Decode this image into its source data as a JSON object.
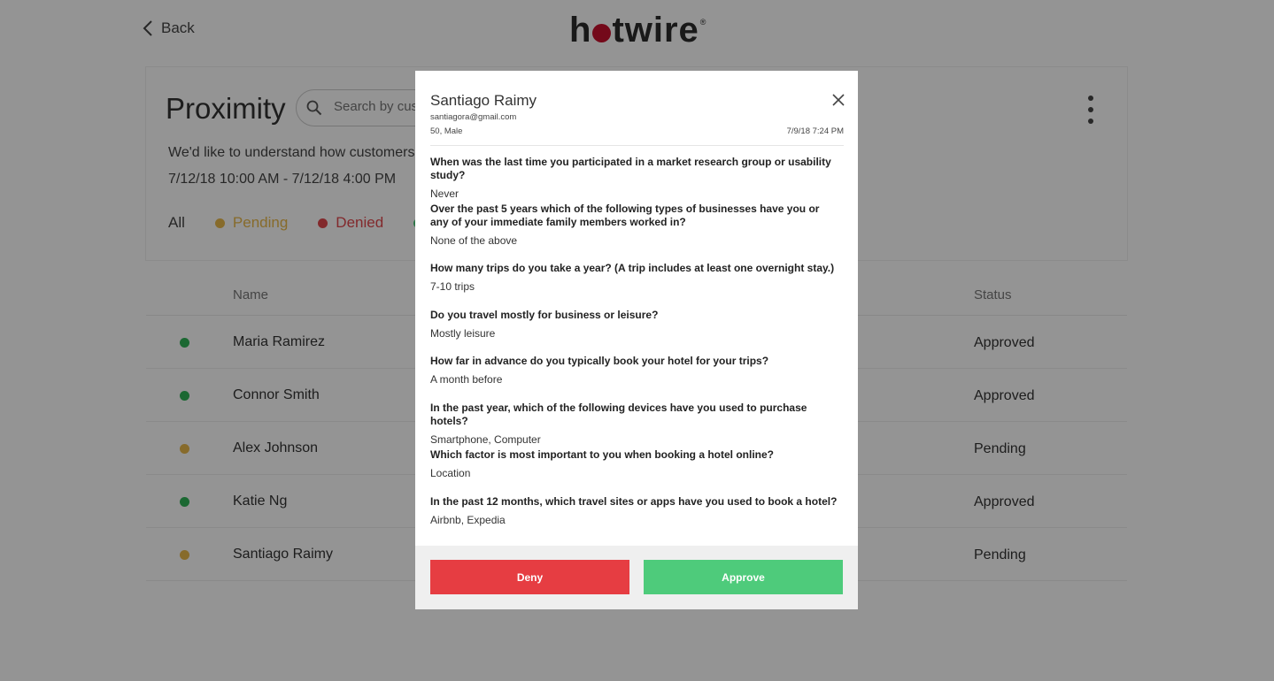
{
  "header": {
    "back_label": "Back",
    "logo_pre": "h",
    "logo_post": "twire",
    "logo_mark": "®"
  },
  "project": {
    "title": "Proximity",
    "search_placeholder": "Search by customer",
    "description": "We'd like to understand how customers ge",
    "date_range": "7/12/18 10:00 AM - 7/12/18 4:00 PM"
  },
  "filters": [
    {
      "label": "All",
      "color": ""
    },
    {
      "label": "Pending",
      "color": "#e8b84a"
    },
    {
      "label": "Denied",
      "color": "#e0474c"
    },
    {
      "label": "",
      "color": "#4ecb7b"
    }
  ],
  "table": {
    "headers": {
      "name": "Name",
      "status": "Status"
    },
    "rows": [
      {
        "name": "Maria Ramirez",
        "status": "Approved",
        "color": "#2fb457"
      },
      {
        "name": "Connor Smith",
        "status": "Approved",
        "color": "#2fb457"
      },
      {
        "name": "Alex Johnson",
        "status": "Pending",
        "color": "#e8b84a"
      },
      {
        "name": "Katie Ng",
        "status": "Approved",
        "color": "#2fb457"
      },
      {
        "name": "Santiago Raimy",
        "status": "Pending",
        "color": "#e8b84a"
      }
    ]
  },
  "modal": {
    "name": "Santiago Raimy",
    "email": "santiagora@gmail.com",
    "demographics": "50, Male",
    "date": "7/9/18 7:24 PM",
    "questions": [
      {
        "q": "When was the last time you participated in a market research group or usability study?",
        "a": "Never"
      },
      {
        "q": "Over the past 5 years which of the following types of businesses have you or any of your immediate family members worked in?",
        "a": "None of the above"
      },
      {
        "q": "How many trips do you take a year? (A trip includes at least one overnight stay.)",
        "a": "7-10 trips"
      },
      {
        "q": "Do you travel mostly for business or leisure?",
        "a": "Mostly leisure"
      },
      {
        "q": "How far in advance do you typically book your hotel for your trips?",
        "a": "A month before"
      },
      {
        "q": "In the past year, which of the following devices have you used to purchase hotels?",
        "a": "Smartphone, Computer"
      },
      {
        "q": "Which factor is most important to you when booking a hotel online?",
        "a": "Location"
      },
      {
        "q": "In the past 12 months, which travel sites or apps have you used to book a hotel?",
        "a": "Airbnb, Expedia"
      }
    ],
    "deny_label": "Deny",
    "approve_label": "Approve"
  },
  "colors": {
    "deny": "#e63d42",
    "approve": "#4ecb7b",
    "brand_dot": "#c8102e"
  }
}
